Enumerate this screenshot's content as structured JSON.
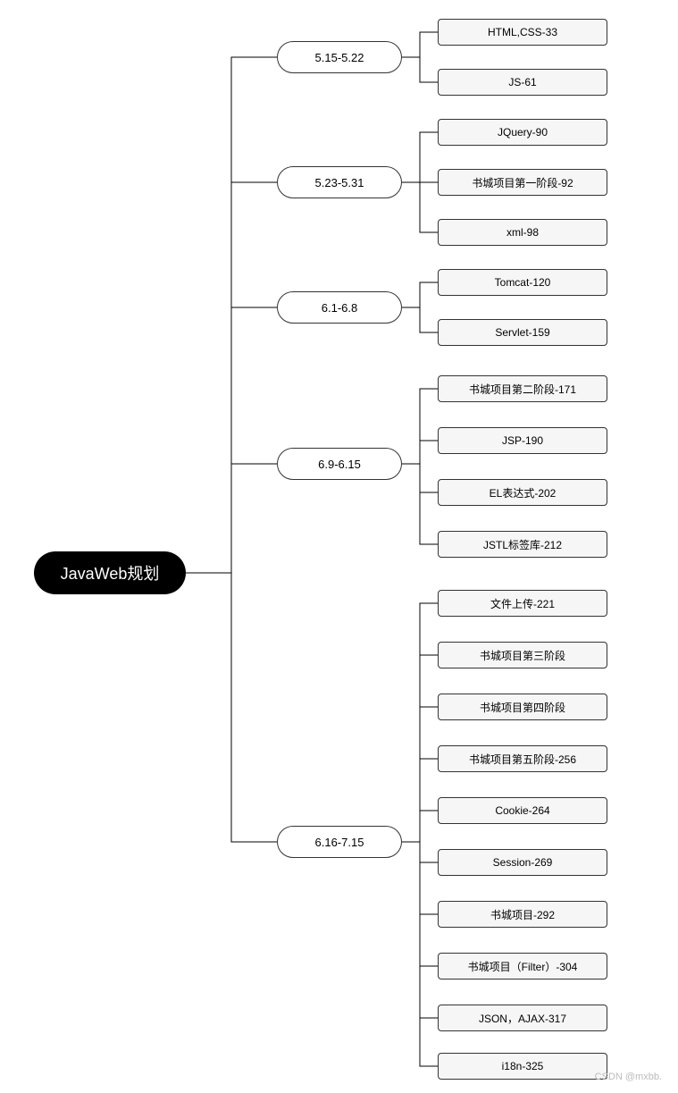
{
  "root": {
    "label": "JavaWeb规划"
  },
  "branches": [
    {
      "label": "5.15-5.22",
      "leaves": [
        "HTML,CSS-33",
        "JS-61"
      ]
    },
    {
      "label": "5.23-5.31",
      "leaves": [
        "JQuery-90",
        "书城项目第一阶段-92",
        "xml-98"
      ]
    },
    {
      "label": "6.1-6.8",
      "leaves": [
        "Tomcat-120",
        "Servlet-159"
      ]
    },
    {
      "label": "6.9-6.15",
      "leaves": [
        "书城项目第二阶段-171",
        "JSP-190",
        "EL表达式-202",
        "JSTL标签库-212"
      ]
    },
    {
      "label": "6.16-7.15",
      "leaves": [
        "文件上传-221",
        "书城项目第三阶段",
        "书城项目第四阶段",
        "书城项目第五阶段-256",
        "Cookie-264",
        "Session-269",
        "书城项目-292",
        "书城项目（Filter）-304",
        "JSON，AJAX-317",
        "i18n-325"
      ]
    }
  ],
  "watermark": "CSDN @mxbb.",
  "chart_data": {
    "type": "mindmap",
    "root": "JavaWeb规划",
    "children": [
      {
        "name": "5.15-5.22",
        "children": [
          "HTML,CSS-33",
          "JS-61"
        ]
      },
      {
        "name": "5.23-5.31",
        "children": [
          "JQuery-90",
          "书城项目第一阶段-92",
          "xml-98"
        ]
      },
      {
        "name": "6.1-6.8",
        "children": [
          "Tomcat-120",
          "Servlet-159"
        ]
      },
      {
        "name": "6.9-6.15",
        "children": [
          "书城项目第二阶段-171",
          "JSP-190",
          "EL表达式-202",
          "JSTL标签库-212"
        ]
      },
      {
        "name": "6.16-7.15",
        "children": [
          "文件上传-221",
          "书城项目第三阶段",
          "书城项目第四阶段",
          "书城项目第五阶段-256",
          "Cookie-264",
          "Session-269",
          "书城项目-292",
          "书城项目（Filter）-304",
          "JSON，AJAX-317",
          "i18n-325"
        ]
      }
    ]
  }
}
